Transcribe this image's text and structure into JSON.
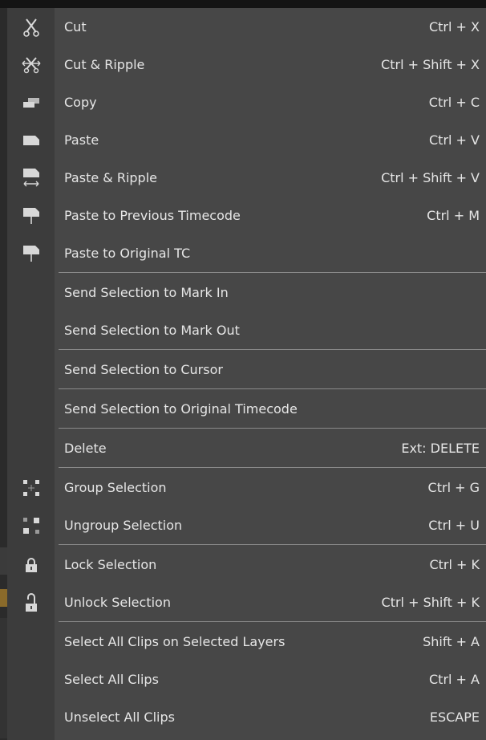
{
  "menu": {
    "items": [
      {
        "label": "Cut",
        "shortcut": "Ctrl + X",
        "icon": "scissors-icon"
      },
      {
        "label": "Cut & Ripple",
        "shortcut": "Ctrl + Shift + X",
        "icon": "cut-ripple-icon"
      },
      {
        "label": "Copy",
        "shortcut": "Ctrl + C",
        "icon": "copy-icon"
      },
      {
        "label": "Paste",
        "shortcut": "Ctrl + V",
        "icon": "paste-icon"
      },
      {
        "label": "Paste & Ripple",
        "shortcut": "Ctrl + Shift + V",
        "icon": "paste-ripple-icon"
      },
      {
        "label": "Paste to Previous Timecode",
        "shortcut": "Ctrl + M",
        "icon": "paste-previous-timecode-icon"
      },
      {
        "label": "Paste to Original TC",
        "shortcut": "",
        "icon": "paste-original-tc-icon"
      },
      {
        "label": "Send Selection to Mark In",
        "shortcut": ""
      },
      {
        "label": "Send Selection to Mark Out",
        "shortcut": ""
      },
      {
        "label": "Send Selection to Cursor",
        "shortcut": ""
      },
      {
        "label": "Send Selection to Original Timecode",
        "shortcut": ""
      },
      {
        "label": "Delete",
        "shortcut": "Ext: DELETE"
      },
      {
        "label": "Group Selection",
        "shortcut": "Ctrl + G",
        "icon": "group-icon"
      },
      {
        "label": "Ungroup Selection",
        "shortcut": "Ctrl + U",
        "icon": "ungroup-icon"
      },
      {
        "label": "Lock Selection",
        "shortcut": "Ctrl + K",
        "icon": "lock-icon"
      },
      {
        "label": "Unlock Selection",
        "shortcut": "Ctrl + Shift + K",
        "icon": "unlock-icon"
      },
      {
        "label": "Select All Clips on Selected Layers",
        "shortcut": "Shift + A"
      },
      {
        "label": "Select All Clips",
        "shortcut": "Ctrl + A"
      },
      {
        "label": "Unselect All Clips",
        "shortcut": "ESCAPE"
      }
    ]
  },
  "colors": {
    "menu_bg": "#474747",
    "gutter_bg": "#3c3c3c",
    "text": "#e6e6e6",
    "separator": "#8a8a8a",
    "icon": "#d8d8d8"
  }
}
